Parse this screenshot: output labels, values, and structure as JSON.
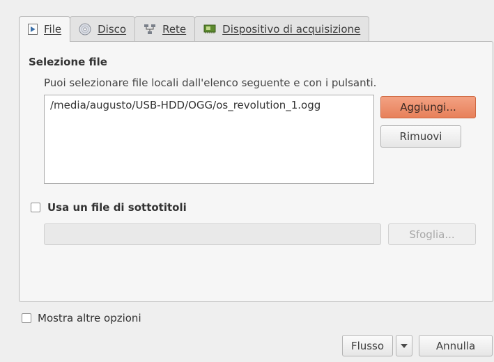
{
  "tabs": [
    {
      "label": "File",
      "icon": "play-file-icon",
      "active": true
    },
    {
      "label": "Disco",
      "icon": "disc-icon",
      "active": false
    },
    {
      "label": "Rete",
      "icon": "network-icon",
      "active": false
    },
    {
      "label": "Dispositivo di acquisizione",
      "icon": "capture-card-icon",
      "active": false
    }
  ],
  "file_selection": {
    "title": "Selezione file",
    "hint": "Puoi selezionare file locali dall'elenco seguente e con i pulsanti.",
    "files": [
      "/media/augusto/USB-HDD/OGG/os_revolution_1.ogg"
    ],
    "add_label": "Aggiungi...",
    "remove_label": "Rimuovi"
  },
  "subtitles": {
    "checkbox_label": "Usa un file di sottotitoli",
    "checked": false,
    "path_value": "",
    "browse_label": "Sfoglia..."
  },
  "more_options": {
    "label": "Mostra altre opzioni",
    "checked": false
  },
  "footer": {
    "stream_label": "Flusso",
    "cancel_label": "Annulla"
  },
  "colors": {
    "accent": "#e98a63",
    "window_bg": "#efefef",
    "panel_bg": "#f6f6f6"
  }
}
